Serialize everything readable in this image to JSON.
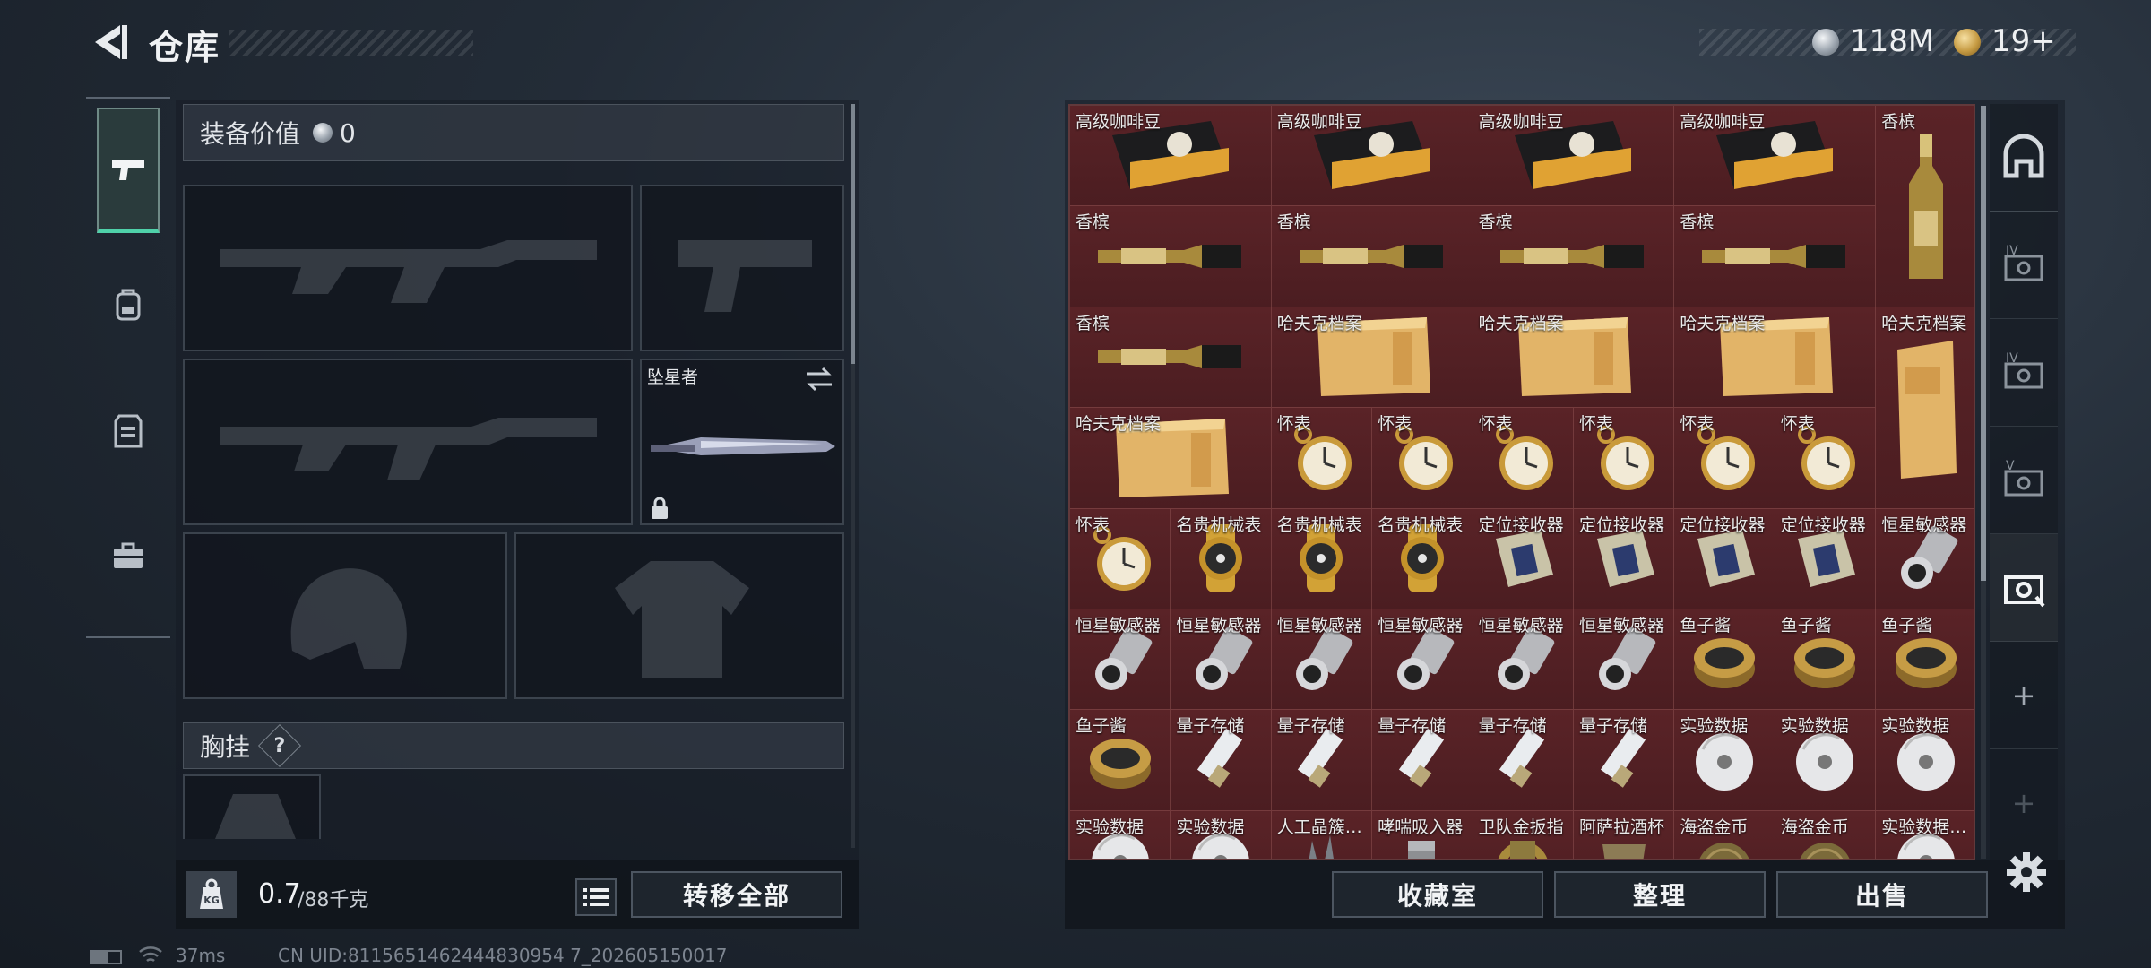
{
  "header": {
    "title": "仓库",
    "currency_amount": "118M",
    "tickets_amount": "19+"
  },
  "loadout": {
    "equipment_value_label": "装备价值",
    "equipment_value": "0",
    "melee_name": "坠星者",
    "chest_rig_label": "胸挂",
    "help_glyph": "?",
    "weight_current": "0.7",
    "weight_max": "/88千克",
    "weight_icon_text": "KG",
    "transfer_all_label": "转移全部"
  },
  "storage": {
    "items": [
      "高级咖啡豆",
      "高级咖啡豆",
      "高级咖啡豆",
      "高级咖啡豆",
      "香槟",
      "香槟",
      "香槟",
      "香槟",
      "香槟",
      "香槟",
      "哈夫克档案",
      "哈夫克档案",
      "哈夫克档案",
      "哈夫克档案",
      "哈夫克档案",
      "怀表",
      "怀表",
      "怀表",
      "怀表",
      "怀表",
      "怀表",
      "怀表",
      "名贵机械表",
      "名贵机械表",
      "名贵机械表",
      "定位接收器",
      "定位接收器",
      "定位接收器",
      "定位接收器",
      "恒星敏感器",
      "恒星敏感器",
      "恒星敏感器",
      "恒星敏感器",
      "恒星敏感器",
      "恒星敏感器",
      "恒星敏感器",
      "鱼子酱",
      "鱼子酱",
      "鱼子酱",
      "鱼子酱",
      "量子存储",
      "量子存储",
      "量子存储",
      "量子存储",
      "量子存储",
      "实验数据",
      "实验数据",
      "实验数据",
      "实验数据",
      "实验数据",
      "人工晶簇…",
      "哮喘吸入器",
      "卫队金扳指",
      "阿萨拉酒杯",
      "海盗金币",
      "海盗金币",
      "实验数据…"
    ],
    "collection_label": "收藏室",
    "organize_label": "整理",
    "sell_label": "出售"
  },
  "sidebar": {
    "add_glyph": "+",
    "tier_labels": [
      "IV",
      "IV",
      "V"
    ]
  },
  "footer": {
    "ping": "37ms",
    "uid": "CN UID:8115651462444830954 7_202605150017"
  }
}
